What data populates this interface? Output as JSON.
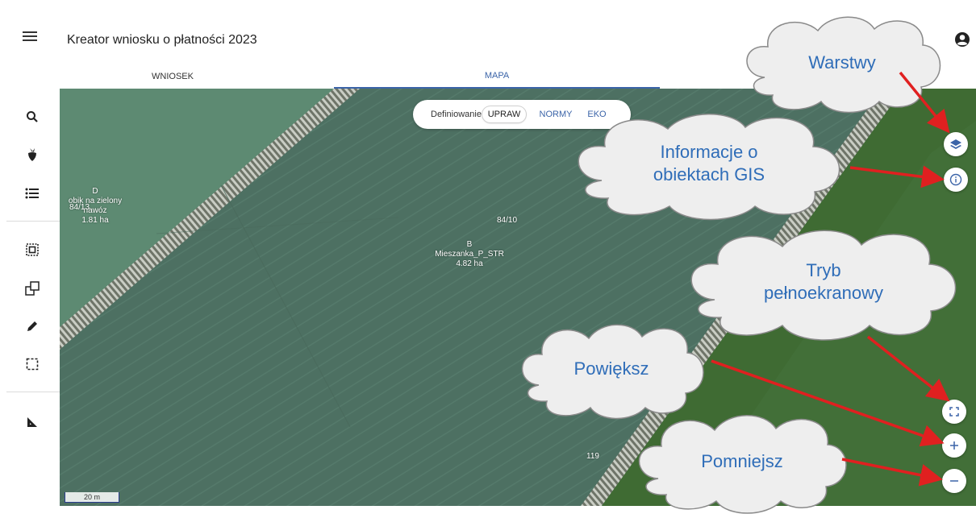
{
  "header": {
    "title": "Kreator wniosku o płatności 2023"
  },
  "tabs": [
    {
      "label": "WNIOSEK",
      "active": false
    },
    {
      "label": "MAPA",
      "active": true
    }
  ],
  "sidebar": {
    "tools": [
      {
        "icon": "search-icon"
      },
      {
        "icon": "beet-icon"
      },
      {
        "icon": "list-icon"
      },
      {
        "icon": "select-inside-icon"
      },
      {
        "icon": "copy-polygon-icon"
      },
      {
        "icon": "pencil-icon"
      },
      {
        "icon": "select-area-icon"
      },
      {
        "icon": "measure-icon"
      }
    ]
  },
  "mode_switch": {
    "prefix": "Definiowanie",
    "options": [
      "UPRAW",
      "NORMY",
      "EKO"
    ],
    "selected": "UPRAW"
  },
  "map": {
    "parcels": [
      {
        "id": "D",
        "name": "obik na zielony nawóz",
        "number": "84/13",
        "area": "1.81 ha"
      },
      {
        "id": "B",
        "name": "Mieszanka_P_STR",
        "area": "4.82 ha"
      }
    ],
    "plot_numbers": [
      "84/10",
      "119"
    ],
    "scale_label": "20 m"
  },
  "callouts": {
    "warstwy": "Warstwy",
    "info": "Informacje o\nobiektach GIS",
    "fullscreen": "Tryb\npełnoekranowy",
    "zoom_in": "Powiększ",
    "zoom_out": "Pomniejsz"
  },
  "colors": {
    "accent": "#3b64a8",
    "callout_text": "#2f6db8",
    "arrow": "#e02020",
    "field": "#4f7163",
    "grass": "#3f6b33"
  }
}
